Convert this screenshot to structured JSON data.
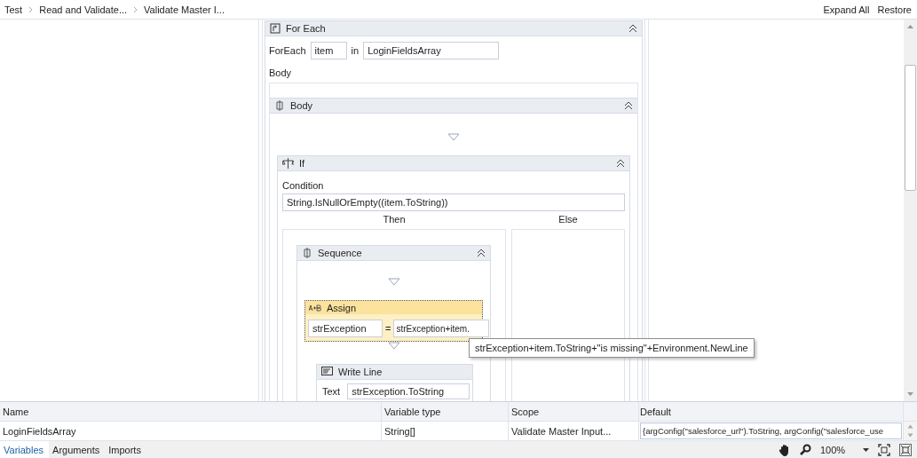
{
  "breadcrumbs": [
    {
      "label": "Test"
    },
    {
      "label": "Read and Validate..."
    },
    {
      "label": "Validate Master I..."
    }
  ],
  "header_actions": [
    "Expand All",
    "Restore"
  ],
  "for_each": {
    "title": "For Each",
    "foreach_label": "ForEach",
    "item": "item",
    "in_label": "in",
    "collection": "LoginFieldsArray",
    "body_label": "Body"
  },
  "body": {
    "title": "Body"
  },
  "if": {
    "title": "If",
    "condition_label": "Condition",
    "condition": "String.IsNullOrEmpty((item.ToString))",
    "then_label": "Then",
    "else_label": "Else"
  },
  "sequence": {
    "title": "Sequence"
  },
  "assign": {
    "title": "Assign",
    "selected": true,
    "to": "strException",
    "equals": "=",
    "value": "strException+item."
  },
  "write_line": {
    "title": "Write Line",
    "text_label": "Text",
    "text": "strException.ToString"
  },
  "tooltip": "strException+item.ToString+\"is missing\"+Environment.NewLine",
  "variables": {
    "columns": [
      "Name",
      "Variable type",
      "Scope",
      "Default"
    ],
    "rows": [
      {
        "name": "LoginFieldsArray",
        "type": "String[]",
        "scope": "Validate Master Input...",
        "default": "{argConfig(\"salesforce_url\").ToString, argConfig(\"salesforce_use"
      }
    ]
  },
  "bottom_tabs": [
    {
      "label": "Variables",
      "selected": true
    },
    {
      "label": "Arguments",
      "selected": false
    },
    {
      "label": "Imports",
      "selected": false
    }
  ],
  "zoom": "100%"
}
